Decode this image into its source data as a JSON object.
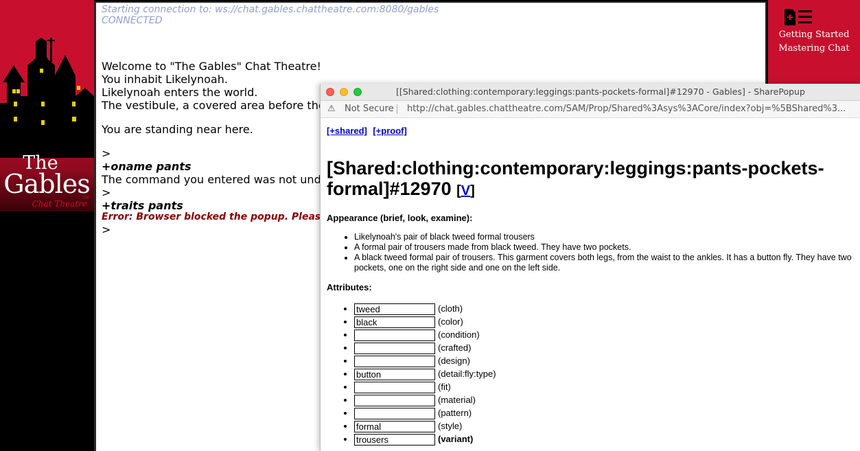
{
  "logo": {
    "line1": "The",
    "line2": "Gables",
    "sub": "Chat Theatre",
    "tm": "TM"
  },
  "help": {
    "icon": "document-menu-icon",
    "link1": "Getting Started",
    "link2": "Mastering Chat"
  },
  "chat": {
    "connecting": "Starting connection to: ws://chat.gables.chattheatre.com:8080/gables",
    "connected": "CONNECTED",
    "welcome": "Welcome to \"The Gables\" Chat Theatre!",
    "inhabit": "You inhabit Likelynoah.",
    "enters": "Likelynoah enters the world.",
    "vestibule": "The vestibule, a covered area before the",
    "standing": "You are standing near here.",
    "prompt1": ">",
    "cmd1": "+oname pants",
    "not_understood": "The command you entered was not und",
    "prompt2": ">",
    "cmd2": "+traits pants",
    "error": "Error: Browser blocked the popup.  Please",
    "prompt3": ">"
  },
  "popup": {
    "title": "[[Shared:clothing:contemporary:leggings:pants-pockets-formal]#12970 - Gables] - SharePopup",
    "not_secure": "Not Secure",
    "url": "http://chat.gables.chattheatre.com/SAM/Prop/Shared%3Asys%3ACore/index?obj=%5BShared%3...",
    "link_shared": "[+shared]",
    "link_proof": "[+proof]",
    "heading": "[Shared:clothing:contemporary:leggings:pants-pockets-formal]#12970",
    "v_link": "V",
    "appearance_label": "Appearance (brief, look, examine):",
    "appearance": [
      "Likelynoah's pair of black tweed formal trousers",
      "A formal pair of trousers made from black tweed. They have two pockets.",
      "A black tweed formal pair of trousers. This garment covers both legs, from the waist to the ankles. It has a button fly. They have two pockets, one on the right side and one on the left side."
    ],
    "attributes_label": "Attributes:",
    "attributes": [
      {
        "value": "tweed",
        "label": "(cloth)"
      },
      {
        "value": "black",
        "label": "(color)"
      },
      {
        "value": "",
        "label": "(condition)"
      },
      {
        "value": "",
        "label": "(crafted)"
      },
      {
        "value": "",
        "label": "(design)"
      },
      {
        "value": "button",
        "label": "(detail:fly:type)"
      },
      {
        "value": "",
        "label": "(fit)"
      },
      {
        "value": "",
        "label": "(material)"
      },
      {
        "value": "",
        "label": "(pattern)"
      },
      {
        "value": "formal",
        "label": "(style)"
      },
      {
        "value": "trousers",
        "label": "(variant)"
      }
    ]
  },
  "colors": {
    "brand_red": "#c8102e",
    "system_text": "#8f9fcf",
    "error_text": "#8b0000",
    "link": "#0000cc"
  }
}
